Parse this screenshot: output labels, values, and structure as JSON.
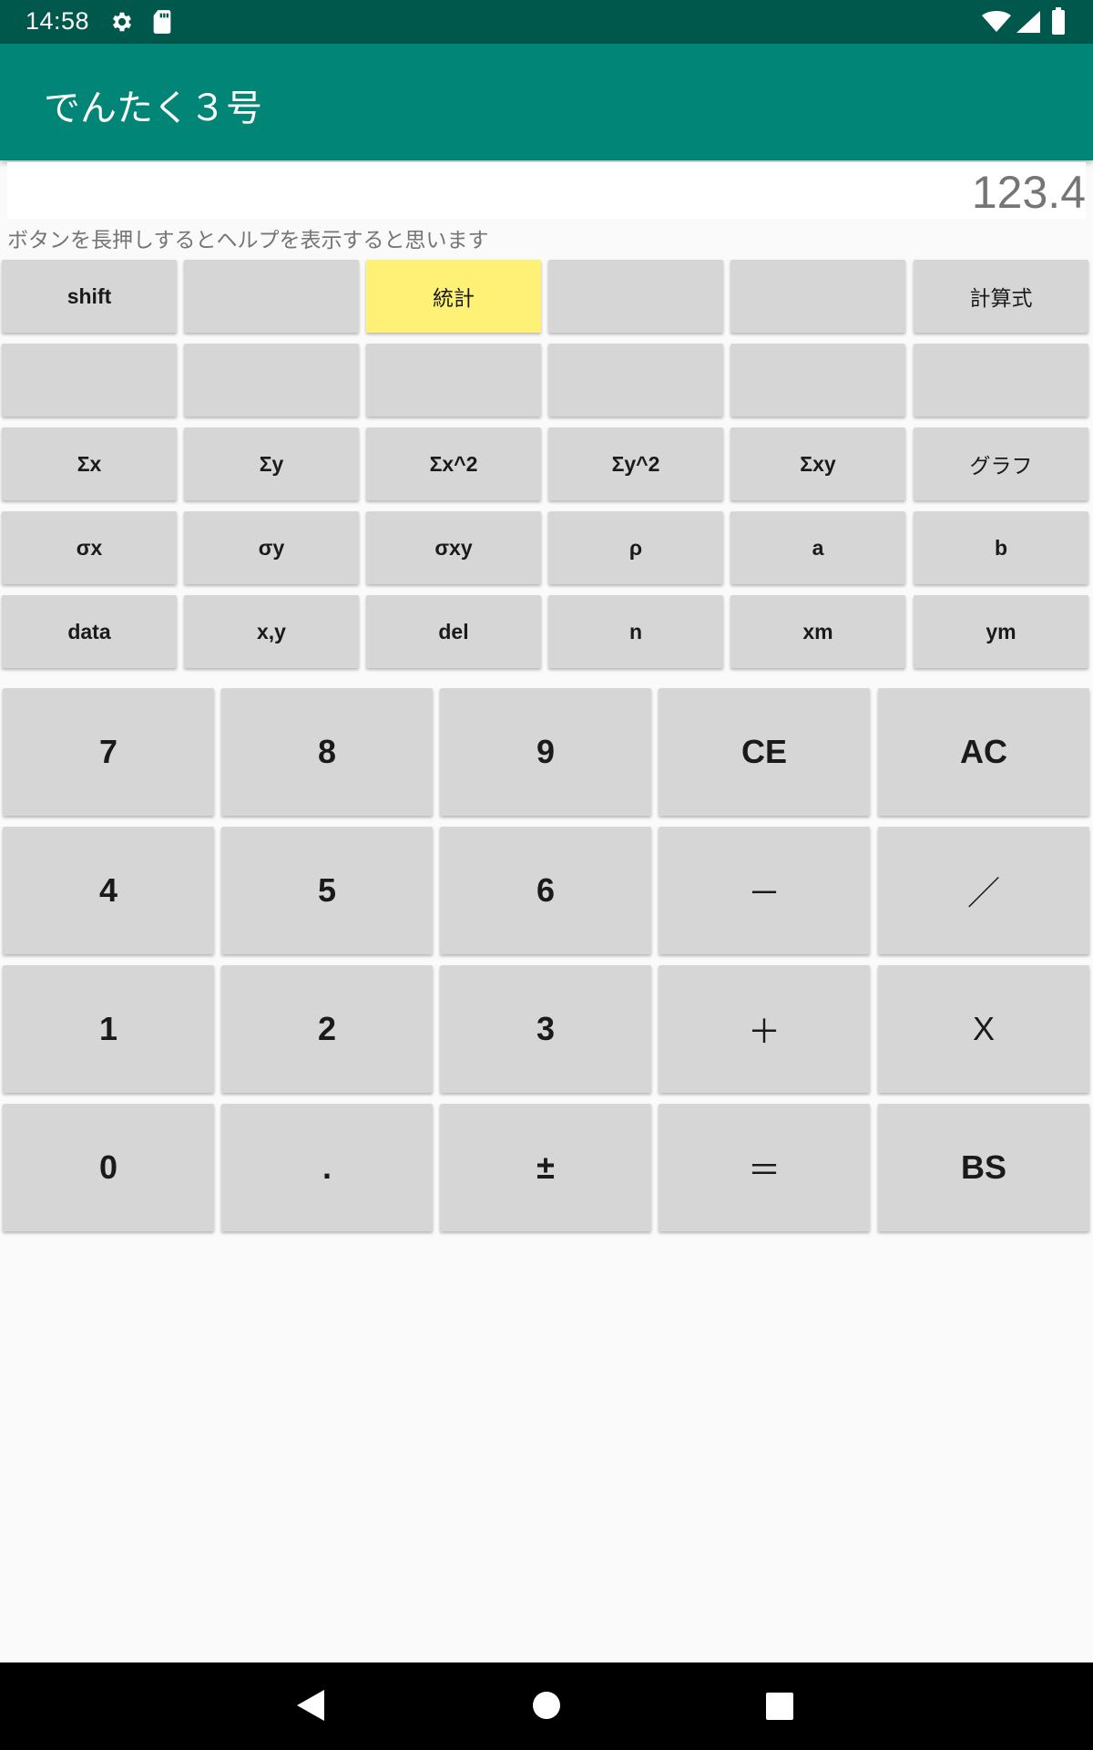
{
  "status_bar": {
    "time": "14:58",
    "icons": [
      "gear-icon",
      "sd-card-icon",
      "wifi-icon",
      "signal-icon",
      "battery-icon"
    ]
  },
  "app_bar": {
    "title": "でんたく３号",
    "color": "#008577"
  },
  "display": {
    "value": "123.4"
  },
  "hint": "ボタンを長押しするとヘルプを表示すると思います",
  "function_rows": [
    [
      "shift",
      "",
      "統計",
      "",
      "",
      "計算式"
    ],
    [
      "",
      "",
      "",
      "",
      "",
      ""
    ],
    [
      "Σx",
      "Σy",
      "Σx^2",
      "Σy^2",
      "Σxy",
      "グラフ"
    ],
    [
      "σx",
      "σy",
      "σxy",
      "ρ",
      "a",
      "b"
    ],
    [
      "data",
      "x,y",
      "del",
      "n",
      "xm",
      "ym"
    ]
  ],
  "keypad_rows": [
    [
      "7",
      "8",
      "9",
      "CE",
      "AC"
    ],
    [
      "4",
      "5",
      "6",
      "－",
      "／"
    ],
    [
      "1",
      "2",
      "3",
      "＋",
      "X"
    ],
    [
      "0",
      ".",
      "±",
      "＝",
      "BS"
    ]
  ],
  "highlight_color": "#fff176",
  "nav_bar": {
    "icons": [
      "back-icon",
      "home-icon",
      "recents-icon"
    ]
  }
}
